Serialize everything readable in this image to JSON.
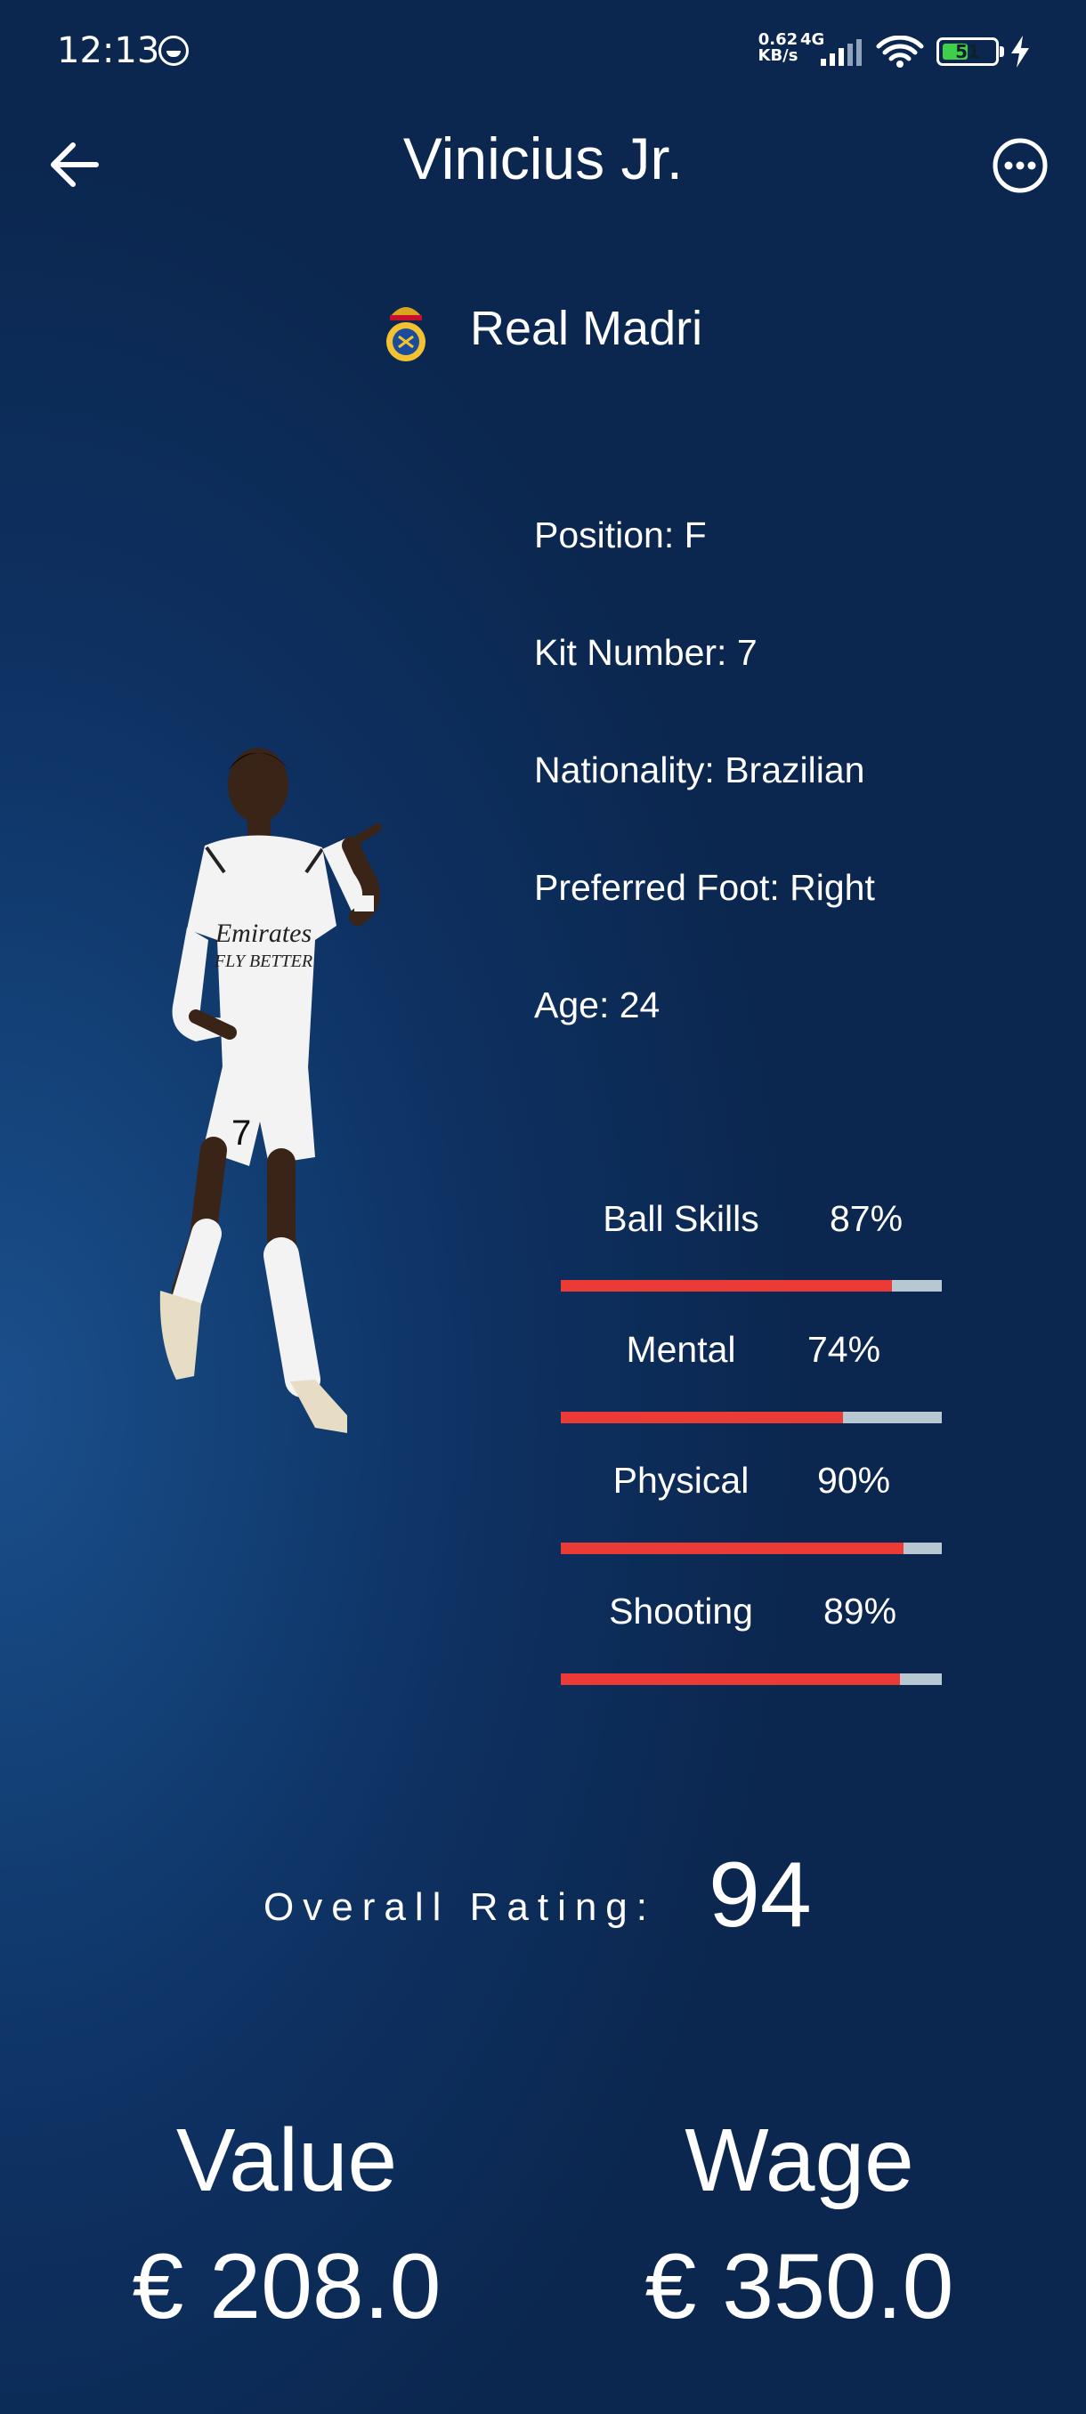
{
  "status_bar": {
    "time": "12:13",
    "net_speed_value": "0.62",
    "net_speed_unit": "KB/s",
    "network_type": "4G",
    "battery_level": "51",
    "icons": [
      "face-icon",
      "signal-icon",
      "wifi-icon",
      "battery-icon",
      "charging-icon"
    ]
  },
  "header": {
    "title": "Vinicius Jr.",
    "back_icon": "arrow-left-icon",
    "more_icon": "more-horizontal-icon"
  },
  "club": {
    "name": "Real Madri",
    "crest_icon": "club-crest-icon"
  },
  "player_info": {
    "position": "Position: F",
    "kit_number": "Kit Number: 7",
    "nationality": "Nationality: Brazilian",
    "preferred_foot": "Preferred Foot: Right",
    "age": "Age: 24"
  },
  "stats": [
    {
      "label": "Ball Skills",
      "percent_text": "87%",
      "value": 87
    },
    {
      "label": "Mental",
      "percent_text": "74%",
      "value": 74
    },
    {
      "label": "Physical",
      "percent_text": "90%",
      "value": 90
    },
    {
      "label": "Shooting",
      "percent_text": "89%",
      "value": 89
    }
  ],
  "rating": {
    "label": "Overall Rating:",
    "value": "94"
  },
  "finance": {
    "value_title": "Value",
    "value_amount": "€ 208.0",
    "wage_title": "Wage",
    "wage_amount": "€ 350.0"
  },
  "colors": {
    "bar_fill": "#ec3a36",
    "bar_track": "#b8c8d2",
    "background": "#0e3162",
    "battery_green": "#3fd04a"
  }
}
